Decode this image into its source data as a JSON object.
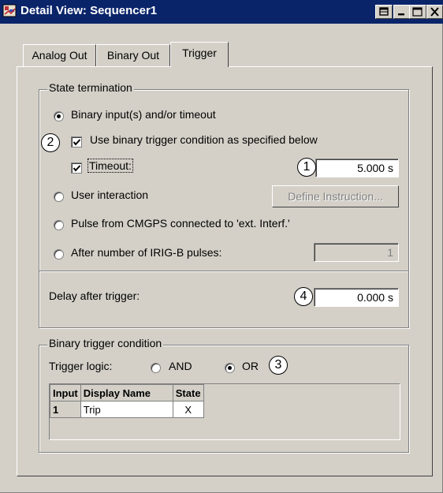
{
  "window": {
    "title": "Detail View: Sequencer1",
    "icon": "app-icon",
    "controls": [
      "restore-icon",
      "minimize-icon",
      "maximize-icon",
      "close-icon"
    ]
  },
  "tabs": [
    {
      "label": "Analog Out",
      "active": false
    },
    {
      "label": "Binary Out",
      "active": false
    },
    {
      "label": "Trigger",
      "active": true
    }
  ],
  "state_termination": {
    "legend": "State termination",
    "option_binary": {
      "label": "Binary input(s) and/or timeout",
      "selected": true
    },
    "use_binary": {
      "label": "Use binary trigger condition as specified below",
      "checked": true
    },
    "timeout": {
      "label": "Timeout:",
      "checked": true,
      "value": "5.000 s"
    },
    "option_user": {
      "label": "User interaction",
      "selected": false
    },
    "define_button": "Define Instruction...",
    "option_pulse": {
      "label": "Pulse from CMGPS connected to 'ext. Interf.'",
      "selected": false
    },
    "option_irig": {
      "label": "After number of IRIG-B pulses:",
      "selected": false,
      "value": "1"
    }
  },
  "delay": {
    "label": "Delay after trigger:",
    "value": "0.000 s"
  },
  "binary_trigger": {
    "legend": "Binary trigger condition",
    "logic_label": "Trigger logic:",
    "and_label": "AND",
    "or_label": "OR",
    "selected": "OR",
    "columns": [
      "Input",
      "Display Name",
      "State"
    ],
    "rows": [
      [
        "1",
        "Trip",
        "X"
      ]
    ]
  },
  "callouts": {
    "c1": "1",
    "c2": "2",
    "c3": "3",
    "c4": "4"
  },
  "colors": {
    "titlebar": "#0a246a",
    "face": "#d4d0c8"
  }
}
